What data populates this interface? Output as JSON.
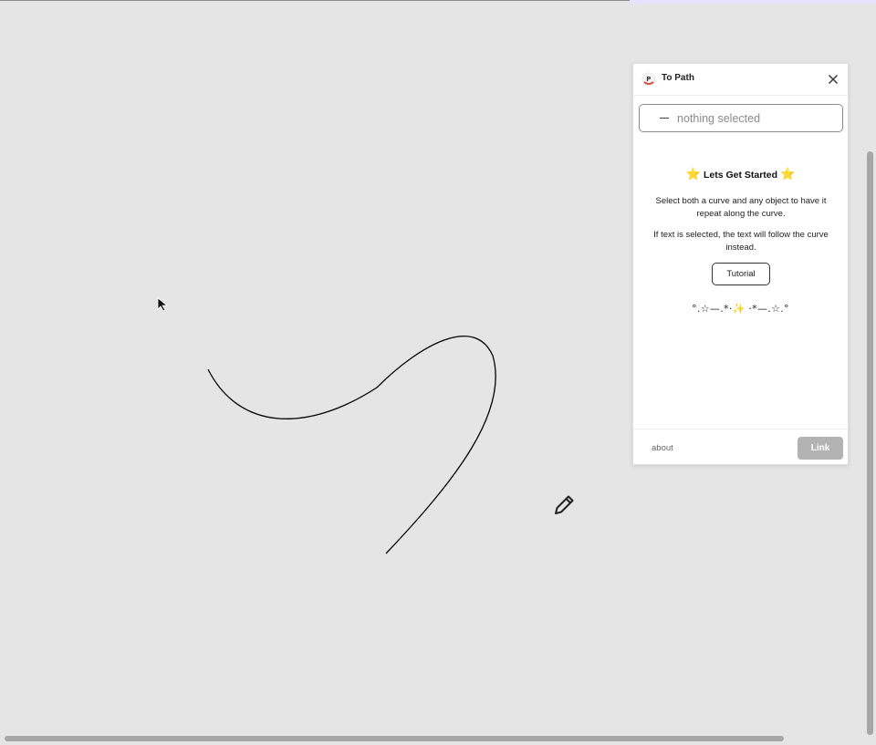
{
  "plugin": {
    "title": "To Path",
    "close_icon": "close-icon",
    "logo_icon": "plugin-logo-icon",
    "selection": {
      "text": "nothing selected",
      "icon": "dash-icon"
    },
    "heading": {
      "star_left": "⭐",
      "text": "Lets Get Started",
      "star_right": "⭐"
    },
    "paragraph_1": "Select both a curve and any object to have it repeat along the curve.",
    "paragraph_2": "If text is selected, the text will follow the curve instead.",
    "tutorial_label": "Tutorial",
    "decoration": "°.☆—.*·✨ ·*—.☆.°",
    "footer": {
      "about_label": "about",
      "link_label": "Link"
    }
  },
  "canvas": {
    "cursor_icon": "arrow-cursor-icon",
    "pencil_icon": "pencil-icon"
  },
  "colors": {
    "canvas_bg": "#e5e5e5",
    "panel_bg": "#ffffff",
    "star": "#f2b705",
    "disabled_button": "#b3b3b3",
    "top_accent": "#e7e3ff"
  }
}
